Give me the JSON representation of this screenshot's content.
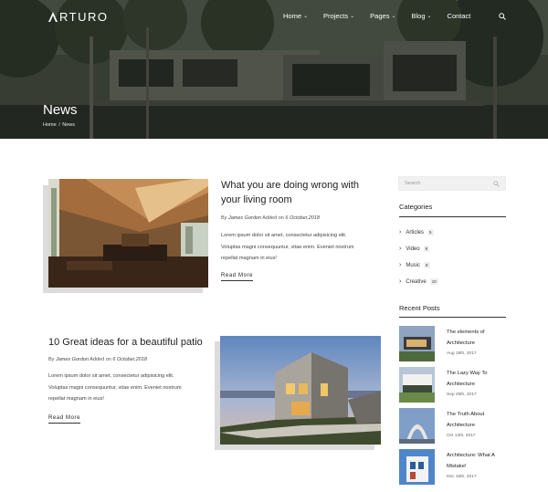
{
  "brand": {
    "logo_text": "RTURO"
  },
  "nav": {
    "items": [
      {
        "label": "Home",
        "has_dropdown": true
      },
      {
        "label": "Projects",
        "has_dropdown": true
      },
      {
        "label": "Pages",
        "has_dropdown": true
      },
      {
        "label": "Blog",
        "has_dropdown": true
      },
      {
        "label": "Contact",
        "has_dropdown": false
      }
    ],
    "search_icon": "search-icon"
  },
  "hero": {
    "title": "News",
    "breadcrumb": {
      "home": "Home",
      "separator": " / ",
      "current": "News"
    }
  },
  "posts": [
    {
      "title_line1": "What you are doing wrong with",
      "title_line2": "your living room",
      "by": "By",
      "author": "James Gordon",
      "added_on": "Added on",
      "date": "6 October,2018",
      "excerpt_line1": "Lorem ipsum dolor sit amet, consectetur adipisicing elit.",
      "excerpt_line2": "Voluptas magni consequuntur, vitae enim. Eveniet nostrum",
      "excerpt_line3": "repellat magnam in eius!",
      "read_more": "Read More"
    },
    {
      "title_line1": "10 Great ideas for a beautiful patio",
      "by": "By",
      "author": "James Gordon",
      "added_on": "Added on",
      "date": "6 October,2018",
      "excerpt_line1": "Lorem ipsum dolor sit amet, consectetur adipisicing elit.",
      "excerpt_line2": "Voluptas magni consequuntur, vitae enim. Eveniet nostrum",
      "excerpt_line3": "repellat magnam in eius!",
      "read_more": "Read More"
    }
  ],
  "sidebar": {
    "search_placeholder": "Search",
    "categories_heading": "Categories",
    "categories": [
      {
        "label": "Articles",
        "count": "5"
      },
      {
        "label": "Video",
        "count": "9"
      },
      {
        "label": "Music",
        "count": "8"
      },
      {
        "label": "Creative",
        "count": "10"
      }
    ],
    "recent_heading": "Recent Posts",
    "recent": [
      {
        "title_line1": "The elements of",
        "title_line2": "Architecture",
        "date": "Aug 18th, 2017"
      },
      {
        "title_line1": "The Lazy Way To",
        "title_line2": "Architecture",
        "date": "Sep 29th, 2017"
      },
      {
        "title_line1": "The Truth About",
        "title_line2": "Architecture",
        "date": "Oct 12th, 2017"
      },
      {
        "title_line1": "Architecture: What A",
        "title_line2": "Mistake!",
        "date": "Dec 16th, 2017"
      }
    ]
  },
  "colors": {
    "hero_overlay": "#2f352c",
    "text": "#222222",
    "shadow_block": "#dcdcdc"
  }
}
